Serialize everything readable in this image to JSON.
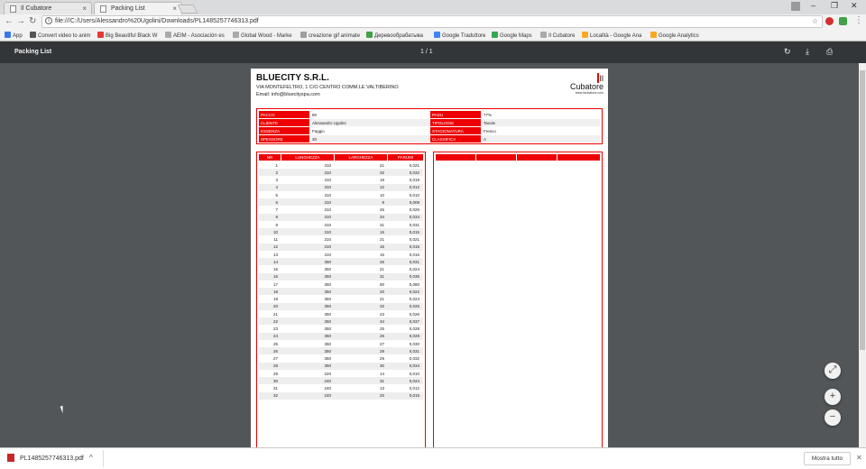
{
  "browser": {
    "tabs": [
      {
        "label": "Il Cubatore",
        "active": false
      },
      {
        "label": "Packing List",
        "active": true
      }
    ],
    "window_controls": [
      "–",
      "❐",
      "✕"
    ],
    "url": "file:///C:/Users/Alessandro%20Ugolini/Downloads/PL1485257746313.pdf",
    "bookmarks": [
      {
        "label": "App",
        "color": "#3b78e7"
      },
      {
        "label": "Convert video to anim",
        "color": "#555"
      },
      {
        "label": "Big Beautiful Black W",
        "color": "#e53935"
      },
      {
        "label": "AEIM - Asociación es",
        "color": "#888"
      },
      {
        "label": "Global Wood - Marke",
        "color": "#888"
      },
      {
        "label": "creazione gif animate",
        "color": "#9e9e9e"
      },
      {
        "label": "Деревообрабатыва",
        "color": "#43a047"
      },
      {
        "label": "Google Traduttore",
        "color": "#4285f4"
      },
      {
        "label": "Google Maps",
        "color": "#34a853"
      },
      {
        "label": "Il Cubatore",
        "color": "#888"
      },
      {
        "label": "Località - Google Ana",
        "color": "#f9a825"
      },
      {
        "label": "Google Analytics",
        "color": "#f9a825"
      }
    ]
  },
  "viewer": {
    "title": "Packing List",
    "page_indicator": "1 / 1",
    "icons": [
      "rotate-icon",
      "download-icon",
      "print-icon"
    ]
  },
  "document": {
    "company": "BLUECITY S.R.L.",
    "address": "VIA MONTEFELTRO, 1 C/O CENTRO COMM.LE VALTIBERINO",
    "email": "Email: info@bluecityspa.com",
    "logo_text": "Il Cubatore",
    "logo_sub": "www.ilcubatore.com",
    "info_left": [
      {
        "label": "PACCO",
        "value": "80"
      },
      {
        "label": "CLIENTE",
        "value": "Alessandro Ugolini"
      },
      {
        "label": "ESSENZA",
        "value": "Faggio"
      },
      {
        "label": "SPESSORE",
        "value": "30"
      }
    ],
    "info_right": [
      {
        "label": "PADU",
        "value": "77%"
      },
      {
        "label": "TIPOLOGIE",
        "value": "Tavole"
      },
      {
        "label": "STAGIONATURA",
        "value": "Fresco"
      },
      {
        "label": "CLASSIFICA",
        "value": "A"
      }
    ],
    "table_headers": [
      "NR",
      "LUNGHEZZA",
      "LARGHEZZA",
      "PARUMI"
    ],
    "rows": [
      [
        "1",
        "310",
        "21",
        "0,021"
      ],
      [
        "2",
        "310",
        "32",
        "0,032"
      ],
      [
        "3",
        "310",
        "18",
        "0,018"
      ],
      [
        "4",
        "310",
        "12",
        "0,012"
      ],
      [
        "5",
        "310",
        "10",
        "0,010"
      ],
      [
        "6",
        "310",
        "9",
        "0,009"
      ],
      [
        "7",
        "310",
        "26",
        "0,026"
      ],
      [
        "8",
        "310",
        "34",
        "0,034"
      ],
      [
        "9",
        "310",
        "31",
        "0,031"
      ],
      [
        "10",
        "310",
        "15",
        "0,015"
      ],
      [
        "11",
        "310",
        "21",
        "0,021"
      ],
      [
        "12",
        "310",
        "15",
        "0,015"
      ],
      [
        "13",
        "310",
        "16",
        "0,016"
      ],
      [
        "14",
        "350",
        "26",
        "0,031"
      ],
      [
        "15",
        "350",
        "21",
        "0,024"
      ],
      [
        "16",
        "350",
        "31",
        "0,035"
      ],
      [
        "17",
        "350",
        "80",
        "0,080"
      ],
      [
        "18",
        "350",
        "20",
        "0,022"
      ],
      [
        "19",
        "350",
        "21",
        "0,024"
      ],
      [
        "20",
        "350",
        "32",
        "0,025"
      ],
      [
        "21",
        "350",
        "23",
        "0,026"
      ],
      [
        "22",
        "350",
        "34",
        "0,037"
      ],
      [
        "23",
        "350",
        "25",
        "0,028"
      ],
      [
        "24",
        "350",
        "26",
        "0,029"
      ],
      [
        "25",
        "350",
        "27",
        "0,030"
      ],
      [
        "26",
        "350",
        "29",
        "0,031"
      ],
      [
        "27",
        "350",
        "29",
        "0,032"
      ],
      [
        "28",
        "350",
        "30",
        "0,034"
      ],
      [
        "29",
        "220",
        "14",
        "0,010"
      ],
      [
        "30",
        "240",
        "31",
        "0,024"
      ],
      [
        "31",
        "240",
        "13",
        "0,012"
      ],
      [
        "32",
        "240",
        "20",
        "0,015"
      ]
    ]
  },
  "download": {
    "filename": "PL1485257746313.pdf",
    "show_all": "Mostra tutto"
  }
}
